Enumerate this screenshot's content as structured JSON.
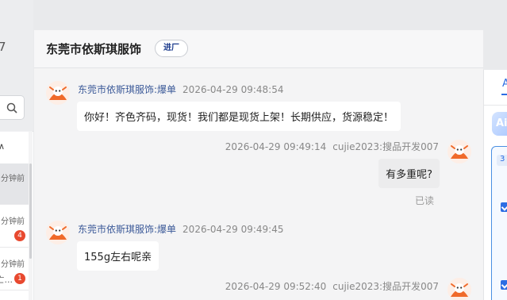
{
  "left_panel": {
    "glyph": "7",
    "section_glyph": "∧",
    "items": [
      {
        "time": "分钟前",
        "preview": "",
        "badge": ""
      },
      {
        "time": "分钟前",
        "preview": "",
        "badge": "4"
      },
      {
        "time": "分钟前",
        "preview": "亡...",
        "badge": "1"
      }
    ]
  },
  "chat": {
    "title": "东莞市依斯琪服饰",
    "tag": "进厂",
    "messages": [
      {
        "side": "left",
        "sender": "东莞市依斯琪服饰:爆单",
        "time": "2026-04-29 09:48:54",
        "text": "你好！齐色齐码，现货！我们都是现货上架！长期供应，货源稳定！"
      },
      {
        "side": "right",
        "sender": "cujie2023:搜品开发007",
        "time": "2026-04-29 09:49:14",
        "text": "有多重呢?",
        "status": "已读"
      },
      {
        "side": "left",
        "sender": "东莞市依斯琪服饰:爆单",
        "time": "2026-04-29 09:49:45",
        "text": "155g左右呢亲"
      },
      {
        "side": "right",
        "sender": "cujie2023:搜品开发007",
        "time": "2026-04-29 09:52:40",
        "text": ""
      }
    ]
  },
  "right_panel": {
    "tab": "A",
    "ai_label": "Ai",
    "card_number": "3"
  },
  "colors": {
    "accent": "#2c6de3",
    "badge": "#e8492f",
    "sender_name": "#3b5998",
    "avatar_orange": "#f06a2a"
  }
}
